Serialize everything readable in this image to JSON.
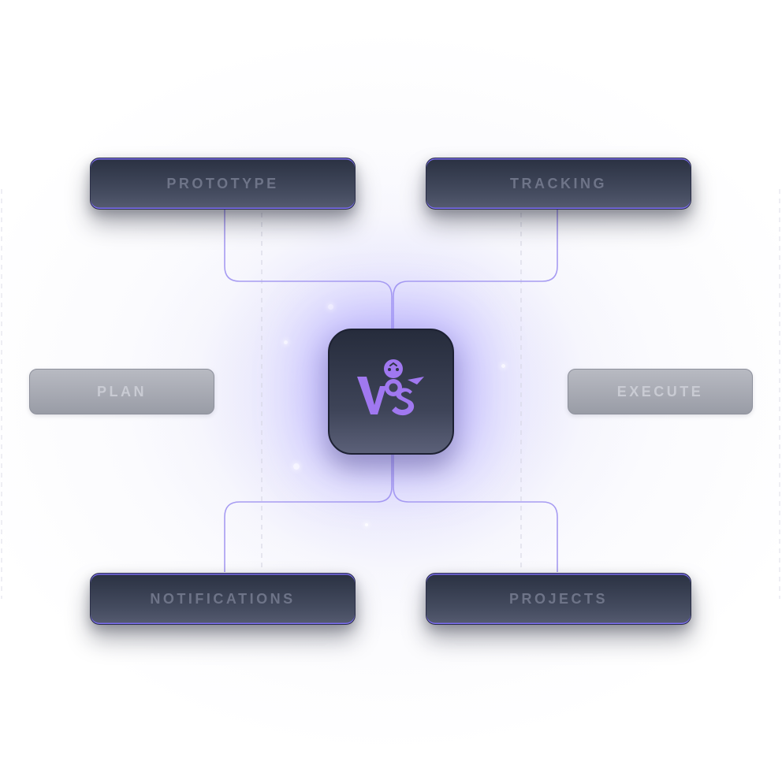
{
  "nodes": {
    "prototype": "PROTOTYPE",
    "tracking": "TRACKING",
    "plan": "PLAN",
    "execute": "EXECUTE",
    "notifications": "NOTIFICATIONS",
    "projects": "PROJECTS"
  },
  "hub": {
    "logo_icon": "ws-mascot-logo-icon"
  },
  "colors": {
    "accent": "#a078f0",
    "connector": "#a79cf2",
    "dark_node": "#3a4052",
    "light_node": "#a6a8b1"
  }
}
